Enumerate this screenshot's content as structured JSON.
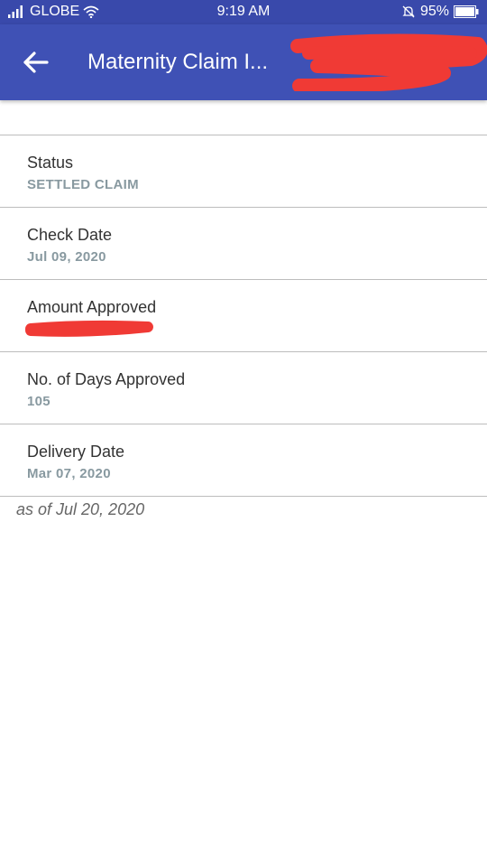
{
  "status_bar": {
    "carrier": "GLOBE",
    "time": "9:19 AM",
    "battery": "95%"
  },
  "app_bar": {
    "title": "Maternity Claim I...",
    "back_icon": "arrow-left-icon",
    "title_redaction_color": "#f03a35"
  },
  "details": [
    {
      "label": "Status",
      "value": "SETTLED CLAIM"
    },
    {
      "label": "Check Date",
      "value": "Jul 09, 2020"
    },
    {
      "label": "Amount Approved",
      "value": ""
    },
    {
      "label": "No. of Days Approved",
      "value": "105"
    },
    {
      "label": "Delivery Date",
      "value": "Mar 07, 2020"
    }
  ],
  "footnote": "as of Jul 20, 2020",
  "colors": {
    "app_bar": "#3f51b5",
    "status_bar": "#3949ab",
    "value_text": "#8899a0",
    "redaction": "#f03a35"
  }
}
